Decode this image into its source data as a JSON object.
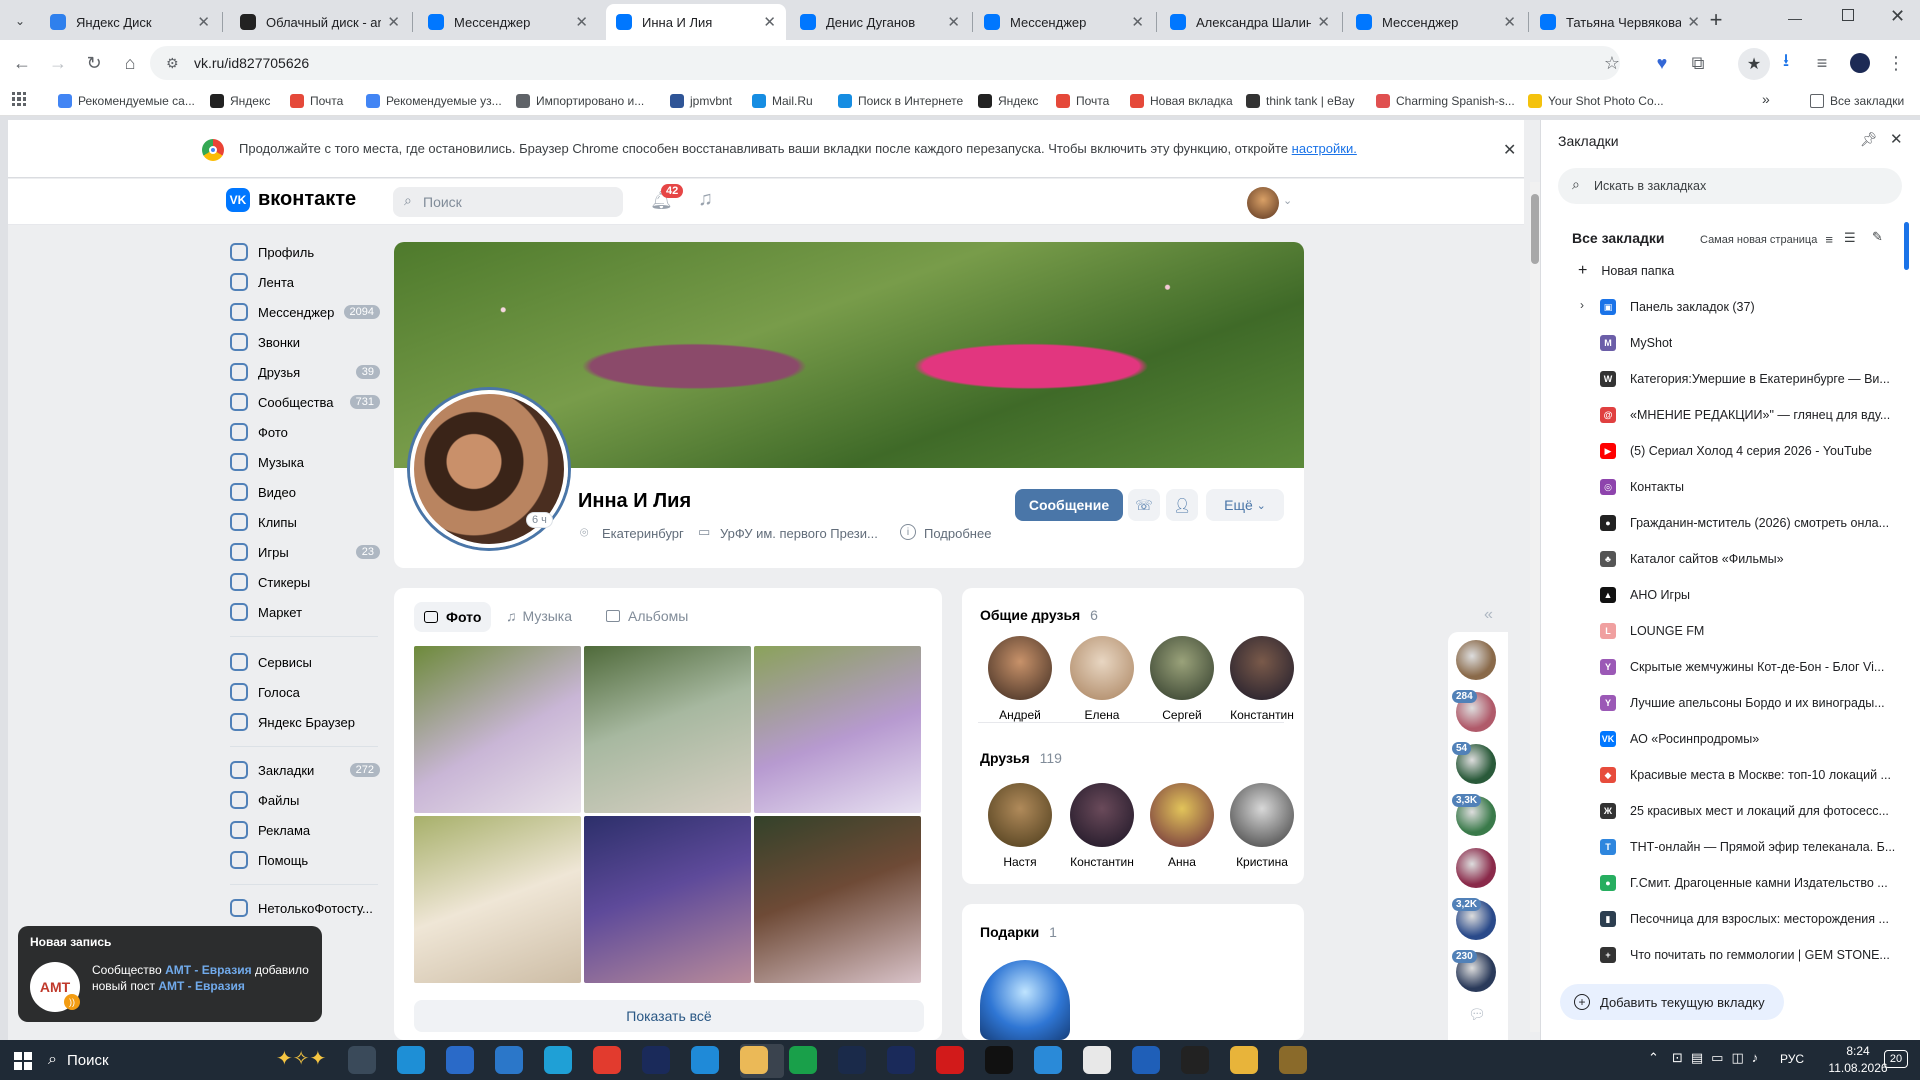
{
  "tabs": [
    {
      "title": "Яндекс Диск",
      "color": "#2f80ed"
    },
    {
      "title": "Облачный диск - art",
      "color": "#222222"
    },
    {
      "title": "Мессенджер",
      "color": "#0077ff"
    },
    {
      "title": "Инна И Лия",
      "color": "#0077ff"
    },
    {
      "title": "Денис Дуганов",
      "color": "#0077ff"
    },
    {
      "title": "Мессенджер",
      "color": "#0077ff"
    },
    {
      "title": "Александра Шалина",
      "color": "#0077ff"
    },
    {
      "title": "Мессенджер",
      "color": "#0077ff"
    },
    {
      "title": "Татьяна Червякова",
      "color": "#0077ff"
    }
  ],
  "address": "vk.ru/id827705626",
  "bookmarks_bar": [
    {
      "label": "Рекомендуемые са...",
      "color": "#4285f4"
    },
    {
      "label": "Яндекс",
      "color": "#222"
    },
    {
      "label": "Почта",
      "color": "#e5493a"
    },
    {
      "label": "Рекомендуемые уз...",
      "color": "#4285f4"
    },
    {
      "label": "Импортировано и...",
      "color": "#5f6368"
    },
    {
      "label": "jpmvbnt",
      "color": "#2f5597"
    },
    {
      "label": "Mail.Ru",
      "color": "#168de2"
    },
    {
      "label": "Поиск в Интернете",
      "color": "#168de2"
    },
    {
      "label": "Яндекс",
      "color": "#222"
    },
    {
      "label": "Почта",
      "color": "#e5493a"
    },
    {
      "label": "Новая вкладка",
      "color": "#e5493a"
    },
    {
      "label": "think tank | eBay",
      "color": "#333"
    },
    {
      "label": "Charming Spanish-s...",
      "color": "#e05050"
    },
    {
      "label": "Your Shot Photo Co...",
      "color": "#f4c20d"
    }
  ],
  "all_bookmarks_label": "Все закладки",
  "notice": {
    "text": "Продолжайте с того места, где остановились. Браузер Chrome способен восстанавливать ваши вкладки после каждого перезапуска. Чтобы включить эту функцию, откройте",
    "link": "настройки."
  },
  "vk": {
    "logo": "вконтакте",
    "search_placeholder": "Поиск",
    "notif_count": "42",
    "nav": [
      {
        "label": "Профиль",
        "count": ""
      },
      {
        "label": "Лента",
        "count": ""
      },
      {
        "label": "Мессенджер",
        "count": "2094"
      },
      {
        "label": "Звонки",
        "count": ""
      },
      {
        "label": "Друзья",
        "count": "39"
      },
      {
        "label": "Сообщества",
        "count": "731"
      },
      {
        "label": "Фото",
        "count": ""
      },
      {
        "label": "Музыка",
        "count": ""
      },
      {
        "label": "Видео",
        "count": ""
      },
      {
        "label": "Клипы",
        "count": ""
      },
      {
        "label": "Игры",
        "count": "23"
      },
      {
        "label": "Стикеры",
        "count": ""
      },
      {
        "label": "Маркет",
        "count": ""
      }
    ],
    "nav2": [
      {
        "label": "Сервисы"
      },
      {
        "label": "Голоса"
      },
      {
        "label": "Яндекс Браузер"
      }
    ],
    "nav3": [
      {
        "label": "Закладки",
        "count": "272"
      },
      {
        "label": "Файлы",
        "count": ""
      },
      {
        "label": "Реклама",
        "count": ""
      },
      {
        "label": "Помощь",
        "count": ""
      }
    ],
    "nav4": [
      {
        "label": "НетолькоФотосту..."
      }
    ],
    "profile": {
      "name": "Инна И Лия",
      "online": "6 ч",
      "city": "Екатеринбург",
      "university": "УрФУ им. первого Прези...",
      "more": "Подробнее",
      "btn_message": "Сообщение",
      "btn_more": "Ещё"
    },
    "photos": {
      "tabs": [
        "Фото",
        "Музыка",
        "Альбомы"
      ],
      "show_all": "Показать всё"
    },
    "common_friends": {
      "title": "Общие друзья",
      "count": "6",
      "items": [
        "Андрей",
        "Елена",
        "Сергей",
        "Константин"
      ]
    },
    "friends": {
      "title": "Друзья",
      "count": "119",
      "items": [
        "Настя",
        "Константин",
        "Анна",
        "Кристина"
      ]
    },
    "gifts": {
      "title": "Подарки",
      "count": "1"
    },
    "right_badges": [
      "284",
      "54",
      "3,3K",
      "3,2K",
      "230"
    ],
    "toast": {
      "title": "Новая запись",
      "text_pre": "Сообщество",
      "community": "АМТ - Евразия",
      "text_mid": "добавило новый пост",
      "community2": "АМТ - Евразия",
      "logo": "AMT"
    }
  },
  "bookmarks_panel": {
    "title": "Закладки",
    "search_placeholder": "Искать в закладках",
    "header": "Все закладки",
    "sort": "Самая новая страница",
    "new_folder": "Новая папка",
    "items": [
      {
        "label": "Панель закладок (37)",
        "color": "#1a73e8",
        "glyph": "▣"
      },
      {
        "label": "MyShot",
        "color": "#6b5ea8",
        "glyph": "M"
      },
      {
        "label": "Категория:Умершие в Екатеринбурге — Ви...",
        "color": "#333",
        "glyph": "W"
      },
      {
        "label": "«МНЕНИЕ РЕДАКЦИИ»\" — глянец для вду...",
        "color": "#e04040",
        "glyph": "@"
      },
      {
        "label": "(5) Сериал Холод 4 серия 2026 - YouTube",
        "color": "#ff0000",
        "glyph": "▶"
      },
      {
        "label": "Контакты",
        "color": "#8e44ad",
        "glyph": "◎"
      },
      {
        "label": "Гражданин-мститель (2026) смотреть онла...",
        "color": "#222",
        "glyph": "●"
      },
      {
        "label": "Каталог сайтов «Фильмы»",
        "color": "#555",
        "glyph": "♣"
      },
      {
        "label": "АНО Игры",
        "color": "#111",
        "glyph": "▲"
      },
      {
        "label": "LOUNGE FM",
        "color": "#f0a0a0",
        "glyph": "L"
      },
      {
        "label": "Скрытые жемчужины Кот-де-Бон - Блог Vi...",
        "color": "#9b59b6",
        "glyph": "Y"
      },
      {
        "label": "Лучшие апельсоны Бордо и их винограды...",
        "color": "#9b59b6",
        "glyph": "Y"
      },
      {
        "label": "АО «Росинпродромы»",
        "color": "#0077ff",
        "glyph": "VK"
      },
      {
        "label": "Красивые места в Москве: топ-10 локаций ...",
        "color": "#e74c3c",
        "glyph": "◆"
      },
      {
        "label": "25 красивых мест и локаций для фотосесс...",
        "color": "#333",
        "glyph": "Ж"
      },
      {
        "label": "ТНТ-онлайн — Прямой эфир телеканала. Б...",
        "color": "#2e86de",
        "glyph": "T"
      },
      {
        "label": "Г.Смит. Драгоценные камни Издательство ...",
        "color": "#27ae60",
        "glyph": "●"
      },
      {
        "label": "Песочница для взрослых: месторождения ...",
        "color": "#2c3e50",
        "glyph": "▮"
      },
      {
        "label": "Что почитать по геммологии | GEM STONE...",
        "color": "#333",
        "glyph": "+"
      }
    ],
    "add_button": "Добавить текущую вкладку"
  },
  "taskbar": {
    "search": "Поиск",
    "lang": "РУС",
    "time": "8:24",
    "date": "11.08.2026",
    "notifications": "20"
  }
}
